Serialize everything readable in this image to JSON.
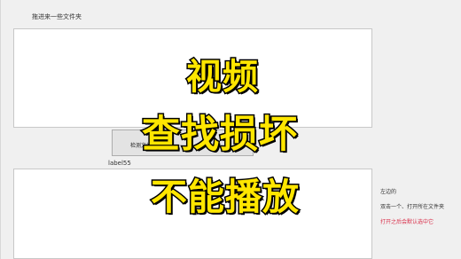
{
  "window": {
    "drop_label": "拖进来一些文件夹",
    "check_button_label": "检测文件",
    "status_label": "label55",
    "side_title": "左边的",
    "side_hint_1": "双击一个、打开所在文件夹",
    "side_hint_2": "打开之后会默认选中它"
  },
  "overlay": {
    "line1": "视频",
    "line2": "查找损坏",
    "line3": "不能播放",
    "fill_color": "#ffe600",
    "stroke_color": "#000000"
  },
  "colors": {
    "window_bg": "#f0f0f0",
    "panel_bg": "#ffffff",
    "hint_red": "#d9304b"
  }
}
